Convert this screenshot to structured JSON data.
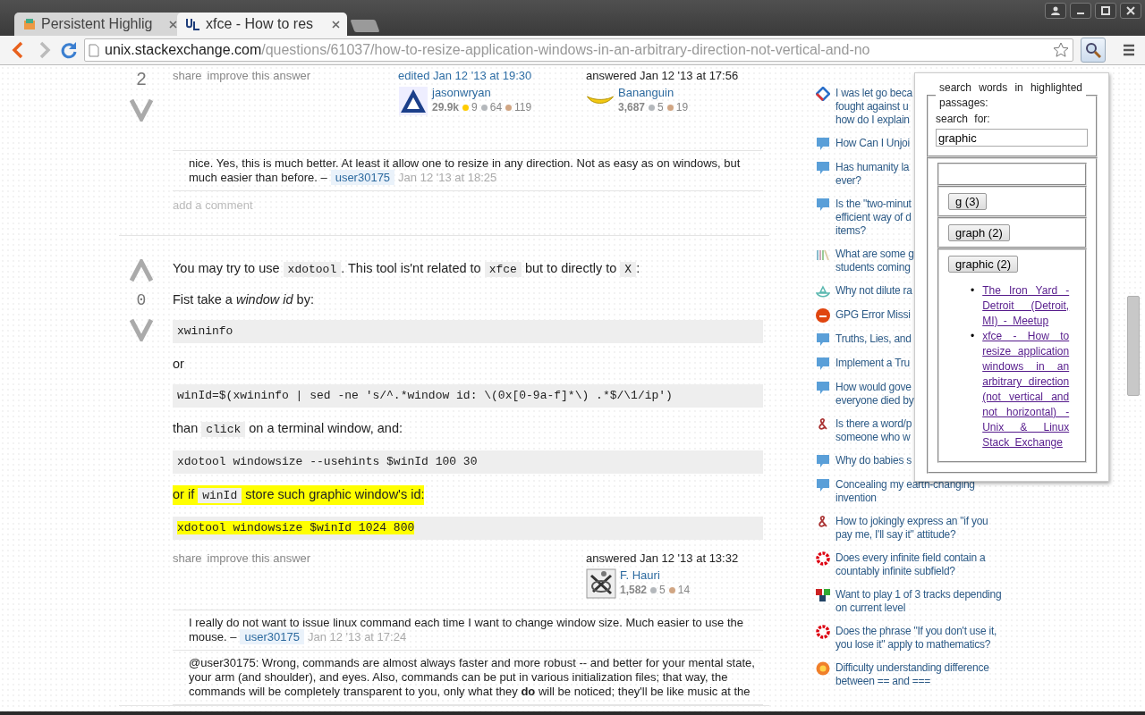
{
  "browser": {
    "tabs": [
      {
        "title": "Persistent Highlig",
        "selected": false
      },
      {
        "title": "xfce - How to res",
        "selected": true
      }
    ],
    "address": {
      "host": "unix.stackexchange.com",
      "path": "/questions/61037/how-to-resize-application-windows-in-an-arbitrary-direction-not-vertical-and-no"
    }
  },
  "posts": [
    {
      "vote": "2",
      "menu": [
        "share",
        "improve this answer"
      ],
      "signatures": [
        {
          "kind": "edited",
          "action": "edited Jan 12 '13 at 19:30",
          "user": "jasonwryan",
          "rep": "29.9k",
          "badges": [
            {
              "color": "#ffcc01",
              "count": "9"
            },
            {
              "color": "#b4b8bc",
              "count": "64"
            },
            {
              "color": "#d1a684",
              "count": "119"
            }
          ]
        },
        {
          "kind": "answered",
          "action": "answered Jan 12 '13 at 17:56",
          "user": "Bananguin",
          "rep": "3,687",
          "badges": [
            {
              "color": "#b4b8bc",
              "count": "5"
            },
            {
              "color": "#d1a684",
              "count": "19"
            }
          ]
        }
      ],
      "comments": [
        {
          "lines": [
            "nice. Yes, this is much better. At least it allow one to resize in any direction. Not as easy as on windows, but",
            "much easier than before. –"
          ],
          "user": "user30175",
          "time": "Jan 12 '13 at 18:25"
        }
      ],
      "add_comment": "add a comment"
    },
    {
      "vote": "0",
      "blocks": [
        {
          "kind": "p",
          "highlighted": false,
          "parts": [
            {
              "kind": "text",
              "text": "You may try to use "
            },
            {
              "kind": "code",
              "text": "xdotool"
            },
            {
              "kind": "text",
              "text": ". This tool is'nt related to "
            },
            {
              "kind": "code",
              "text": "xfce"
            },
            {
              "kind": "text",
              "text": " but to directly to "
            },
            {
              "kind": "code",
              "text": "X"
            },
            {
              "kind": "text",
              "text": ":"
            }
          ]
        },
        {
          "kind": "p",
          "highlighted": false,
          "parts": [
            {
              "kind": "text",
              "text": "Fist take a *window id* by:"
            }
          ]
        },
        {
          "kind": "pre",
          "highlighted": false,
          "text": "xwininfo"
        },
        {
          "kind": "p",
          "highlighted": false,
          "parts": [
            {
              "kind": "text",
              "text": "or"
            }
          ]
        },
        {
          "kind": "pre",
          "highlighted": false,
          "text": "winId=$(xwininfo | sed -ne 's/^.*window id: \\(0x[0-9a-f]*\\) .*$/\\1/ip')"
        },
        {
          "kind": "p",
          "highlighted": false,
          "parts": [
            {
              "kind": "text",
              "text": "than "
            },
            {
              "kind": "code",
              "text": "click"
            },
            {
              "kind": "text",
              "text": " on a terminal window, and:"
            }
          ]
        },
        {
          "kind": "pre",
          "highlighted": false,
          "text": "xdotool windowsize --usehints $winId 100 30"
        },
        {
          "kind": "p",
          "highlighted": true,
          "parts": [
            {
              "kind": "text",
              "text": "or if "
            },
            {
              "kind": "code",
              "text": "winId"
            },
            {
              "kind": "text",
              "text": " store such graphic window's id:"
            }
          ]
        },
        {
          "kind": "pre",
          "highlighted": true,
          "text": "xdotool windowsize $winId 1024 800"
        }
      ],
      "menu": [
        "share",
        "improve this answer"
      ],
      "signatures": [
        {
          "kind": "answered",
          "action": "answered Jan 12 '13 at 13:32",
          "user": "F. Hauri",
          "rep": "1,582",
          "badges": [
            {
              "color": "#b4b8bc",
              "count": "5"
            },
            {
              "color": "#d1a684",
              "count": "14"
            }
          ]
        }
      ],
      "comments": [
        {
          "lines": [
            "I really do not want to issue linux command each time I want to change window size. Much easier to use the",
            "mouse. –"
          ],
          "user": "user30175",
          "time": "Jan 12 '13 at 17:24"
        },
        {
          "lines": [
            "@user30175: Wrong, commands are almost always faster and more robust -- and better for your mental state,",
            "your arm (and shoulder), and eyes. Also, commands can be put in various initialization files; that way, the",
            "commands will be completely transparent to you, only what they **do** will be noticed; they'll be like music at the"
          ]
        }
      ]
    }
  ],
  "sidebar": [
    {
      "kind": "diamond",
      "lines": [
        "I was let go beca",
        "fought against u",
        "how do I explain"
      ]
    },
    {
      "kind": "bubble",
      "lines": [
        "How Can I Unjoi"
      ]
    },
    {
      "kind": "bubble",
      "lines": [
        "Has humanity la",
        "ever?"
      ]
    },
    {
      "kind": "bubble",
      "lines": [
        "Is the \"two-minut",
        "efficient way of d",
        "items?"
      ]
    },
    {
      "kind": "books",
      "lines": [
        "What are some g",
        "students coming"
      ]
    },
    {
      "kind": "bowl",
      "lines": [
        "Why not dilute ra"
      ]
    },
    {
      "kind": "ask",
      "lines": [
        "GPG Error Missi"
      ]
    },
    {
      "kind": "bubble",
      "lines": [
        "Truths, Lies, and"
      ]
    },
    {
      "kind": "bubble",
      "lines": [
        "Implement a Tru"
      ]
    },
    {
      "kind": "bubble",
      "lines": [
        "How would gove",
        "everyone died by"
      ]
    },
    {
      "kind": "amp",
      "lines": [
        "Is there a word/p",
        "someone who w"
      ]
    },
    {
      "kind": "bubble",
      "lines": [
        "Why do babies s"
      ]
    },
    {
      "kind": "bubble",
      "lines": [
        "Concealing my earth-changing",
        "invention"
      ]
    },
    {
      "kind": "amp",
      "lines": [
        "How to jokingly express an \"if you",
        "pay me, I'll say it\" attitude?"
      ]
    },
    {
      "kind": "flower",
      "lines": [
        "Does every infinite field contain a",
        "countably infinite subfield?"
      ]
    },
    {
      "kind": "cubes",
      "lines": [
        "Want to play 1 of 3 tracks depending",
        "on current level"
      ]
    },
    {
      "kind": "flower",
      "lines": [
        "Does the phrase \"If you don't use it,",
        "you lose it\" apply to mathematics?"
      ]
    },
    {
      "kind": "sun",
      "lines": [
        "Difficulty understanding difference",
        "between == and ==="
      ]
    }
  ],
  "popup": {
    "legend": "search words in highlighted passages:",
    "label": "search for:",
    "value": "graphic",
    "bullet": "•",
    "groups": [
      {
        "button": "g (3)",
        "expanded": false
      },
      {
        "button": "graph (2)",
        "expanded": false
      },
      {
        "button": "graphic (2)",
        "expanded": true,
        "links": [
          "The Iron Yard - Detroit (Detroit, MI) - Meetup",
          "xfce - How to resize application windows in an arbitrary direction (not vertical and not horizontal) - Unix & Linux Stack Exchange"
        ]
      }
    ]
  }
}
